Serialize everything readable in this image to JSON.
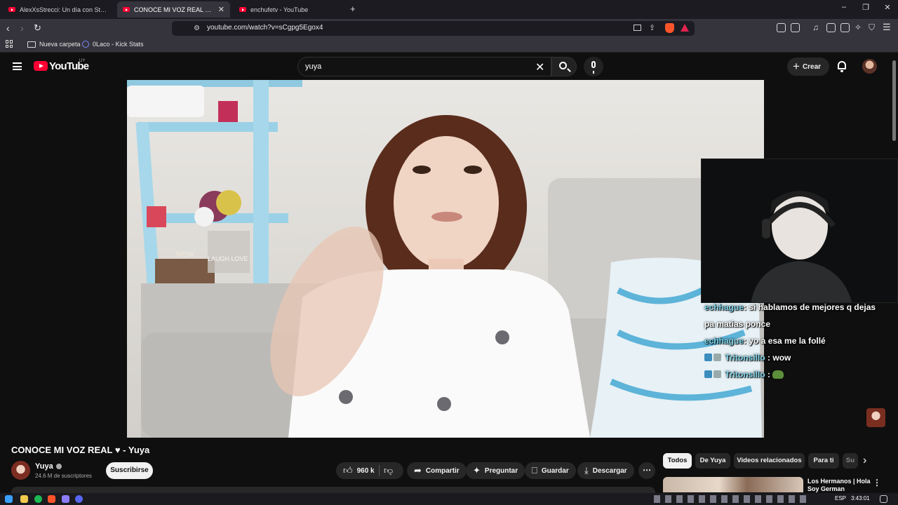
{
  "browser": {
    "tabs": [
      {
        "title": "AlexXsStrecci: Un día con Strecci - Yo..."
      },
      {
        "title": "CONOCE MI VOZ REAL ♥ - Yuya",
        "active": true
      },
      {
        "title": "enchufetv - YouTube"
      }
    ],
    "new_tab": "+",
    "url": "youtube.com/watch?v=sCgpg5Egox4",
    "bookmarks": [
      {
        "label": "Nueva carpeta"
      },
      {
        "label": "0Laco - Kick Stats"
      }
    ]
  },
  "youtube": {
    "logo_text": "YouTube",
    "country": "UY",
    "search_value": "yuya",
    "create_label": "Crear"
  },
  "video": {
    "title": "CONOCE MI VOZ REAL ♥ - Yuya",
    "channel": "Yuya",
    "subscribers": "24.6 M de suscriptores",
    "subscribe_label": "Suscribirse",
    "likes": "960 k",
    "actions": {
      "share": "Compartir",
      "ask": "Preguntar",
      "save": "Guardar",
      "download": "Descargar"
    },
    "scene_sign_new": "NEW",
    "scene_sign_love": "LAUGH LOVE"
  },
  "stream_chat": [
    {
      "user": "echhague",
      "text": ": si hablamos de mejores q dejas"
    },
    {
      "user": "",
      "text": "pa matias ponce"
    },
    {
      "user": "echhague",
      "text": ": yo a esa me la follé"
    },
    {
      "user": "Tritonsillo",
      "text": ": wow"
    },
    {
      "user": "Tritonsillo",
      "text": ":"
    }
  ],
  "chips": [
    "Todos",
    "De Yuya",
    "Videos relacionados",
    "Para ti",
    "Su"
  ],
  "recommended": {
    "title": "Los Hermanos | Hola Soy German"
  },
  "taskbar": {
    "lang": "ESP",
    "time": "3:43:01"
  },
  "colors": {
    "youtube_red": "#ff0033",
    "background": "#0f0f0f",
    "chat_user": "#7fd3e8"
  }
}
